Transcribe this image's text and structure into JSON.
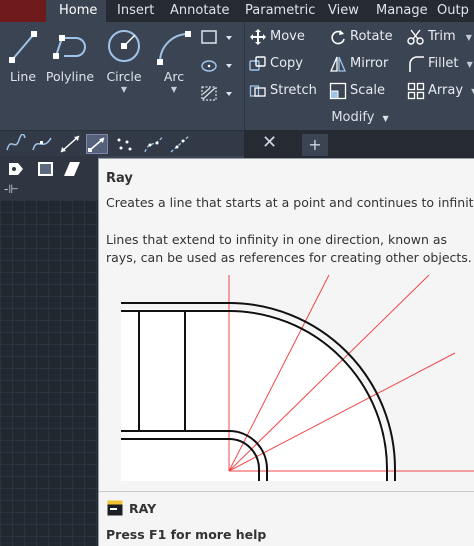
{
  "ribbon_tabs": [
    "Home",
    "Insert",
    "Annotate",
    "Parametric",
    "View",
    "Manage",
    "Outp"
  ],
  "draw_panel": {
    "line": "Line",
    "polyline": "Polyline",
    "circle": "Circle",
    "arc": "Arc"
  },
  "modify_panel": {
    "title": "Modify",
    "move": "Move",
    "rotate": "Rotate",
    "trim": "Trim",
    "copy": "Copy",
    "mirror": "Mirror",
    "fillet": "Fillet",
    "stretch": "Stretch",
    "scale": "Scale",
    "array": "Array"
  },
  "file_tabs": {
    "close": "✕",
    "new": "+"
  },
  "tooltip": {
    "title": "Ray",
    "description": "Creates a line that starts at a point and continues to infinity",
    "detail": "Lines that extend to infinity in one direction, known as rays, can be used as references for creating other objects.",
    "command": "RAY",
    "help": "Press F1 for more help"
  },
  "colors": {
    "ribbon_bg": "#3b4453",
    "tab_strip_bg": "#252a33",
    "tooltip_bg": "#f5f5f5",
    "ray_red": "#f0484a",
    "accent_blue": "#9fc4ea"
  }
}
